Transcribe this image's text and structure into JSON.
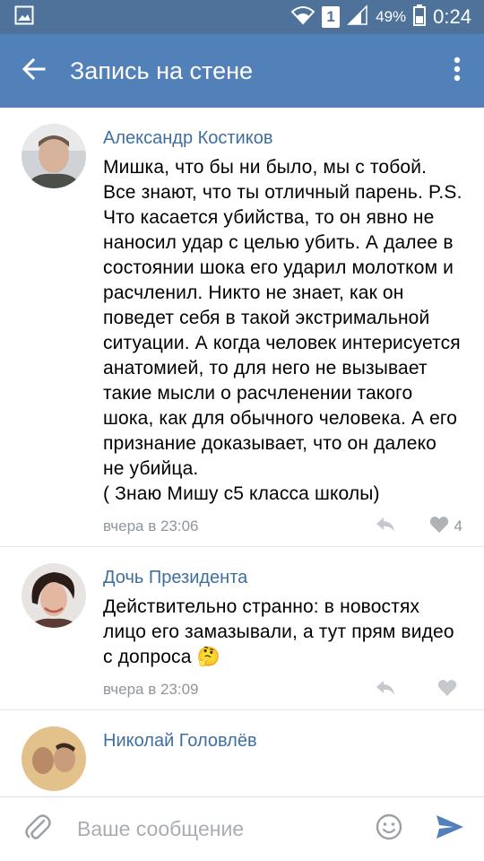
{
  "status_bar": {
    "battery": "49%",
    "sim": "1",
    "time": "0:24"
  },
  "app_bar": {
    "title": "Запись на стене"
  },
  "comments": [
    {
      "author": "Александр Костиков",
      "text": "Мишка, что бы ни было, мы с тобой. Все знают, что ты отличный парень. P.S. Что касается убийства, то он явно не наносил удар с целью убить. А далее в состоянии шока его ударил молотком и расчленил. Никто не знает, как он поведет себя в такой экстримальной ситуации. А когда человек интерисуется анатомией, то для него не вызывает такие мысли о расчленении такого шока, как для обычного человека. А его признание доказывает, что он далеко не убийца.\n( Знаю Мишу с5 класса школы)",
      "time": "вчера в 23:06",
      "likes": "4"
    },
    {
      "author": "Дочь Президента",
      "text": "Действительно странно: в новостях лицо его замазывали, а тут прям видео с допроса 🤔",
      "time": "вчера в 23:09",
      "likes": ""
    },
    {
      "author": "Николай Головлёв",
      "text": "",
      "time": "",
      "likes": ""
    }
  ],
  "composer": {
    "placeholder": "Ваше сообщение"
  },
  "colors": {
    "status_bar": "#4e729a",
    "app_bar": "#5181b8",
    "author_link": "#3f6f9f",
    "meta_gray": "#8f959c",
    "icon_gray": "#c5c9cd",
    "send_blue": "#5181b8"
  },
  "icons": {
    "status_left": "image-notification-icon",
    "wifi": "wifi-icon",
    "signal": "signal-icon",
    "battery": "battery-icon",
    "back": "arrow-back-icon",
    "menu": "more-vert-icon",
    "reply": "reply-icon",
    "like": "heart-icon",
    "attach": "paperclip-icon",
    "emoji": "smiley-icon",
    "send": "send-icon"
  }
}
